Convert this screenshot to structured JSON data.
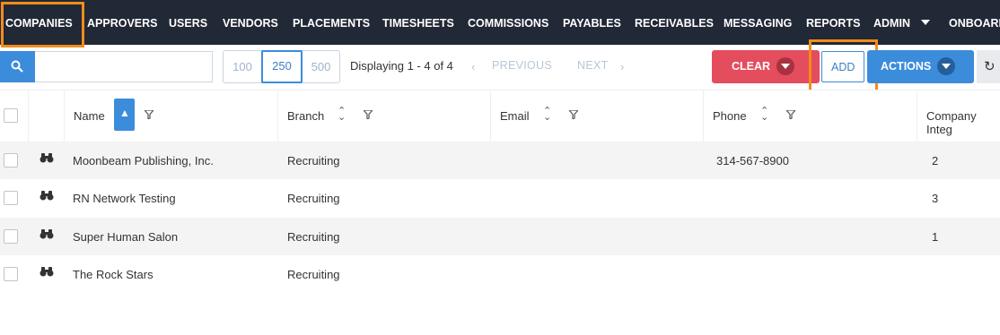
{
  "nav": {
    "items": [
      "COMPANIES",
      "APPROVERS",
      "USERS",
      "VENDORS",
      "PLACEMENTS",
      "TIMESHEETS",
      "COMMISSIONS",
      "PAYABLES",
      "RECEIVABLES",
      "MESSAGING",
      "REPORTS",
      "ADMIN",
      "ONBOARDI"
    ],
    "active": "COMPANIES"
  },
  "toolbar": {
    "search_placeholder": "",
    "page_sizes": [
      "100",
      "250",
      "500"
    ],
    "selected_page_size": "250",
    "displaying": "Displaying 1 - 4 of 4",
    "previous": "PREVIOUS",
    "next": "NEXT",
    "clear": "CLEAR",
    "add": "ADD",
    "actions": "ACTIONS"
  },
  "table": {
    "columns": [
      "Name",
      "Branch",
      "Email",
      "Phone",
      "Company Integ"
    ],
    "rows": [
      {
        "name": "Moonbeam Publishing, Inc.",
        "branch": "Recruiting",
        "email": "",
        "phone": "314-567-8900",
        "integ": "2"
      },
      {
        "name": "RN Network Testing",
        "branch": "Recruiting",
        "email": "",
        "phone": "",
        "integ": "3"
      },
      {
        "name": "Super Human Salon",
        "branch": "Recruiting",
        "email": "",
        "phone": "",
        "integ": "1"
      },
      {
        "name": "The Rock Stars",
        "branch": "Recruiting",
        "email": "",
        "phone": "",
        "integ": ""
      }
    ]
  },
  "colors": {
    "nav_bg": "#212836",
    "primary": "#3c8cdc",
    "danger": "#e34d5d",
    "highlight": "#f28c1b"
  }
}
